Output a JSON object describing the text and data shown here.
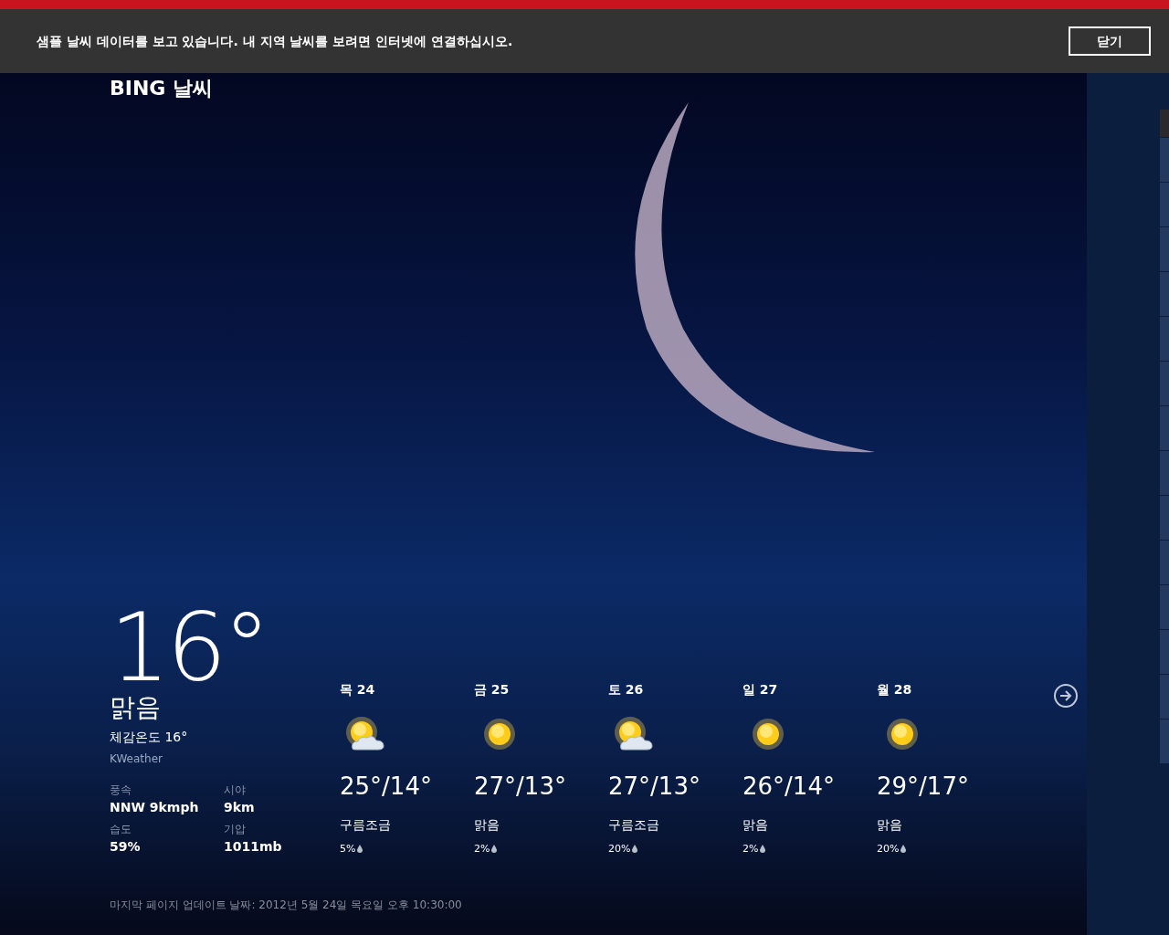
{
  "banner": {
    "message": "샘플 날씨 데이터를 보고 있습니다. 내 지역 날씨를 보려면 인터넷에 연결하십시오.",
    "button": "닫기"
  },
  "app_title": "BING 날씨",
  "current": {
    "temperature": "16°",
    "condition": "맑음",
    "feels_like": "체감온도 16°",
    "provider": "KWeather",
    "details": [
      {
        "label": "풍속",
        "value": "NNW 9kmph"
      },
      {
        "label": "시야",
        "value": "9km"
      },
      {
        "label": "습도",
        "value": "59%"
      },
      {
        "label": "기압",
        "value": "1011mb"
      }
    ]
  },
  "forecast": [
    {
      "day": "목 24",
      "kind": "partly-cloudy",
      "temps": "25°/14°",
      "condition": "구름조금",
      "precip": "5%"
    },
    {
      "day": "금 25",
      "kind": "sunny",
      "temps": "27°/13°",
      "condition": "맑음",
      "precip": "2%"
    },
    {
      "day": "토 26",
      "kind": "partly-cloudy",
      "temps": "27°/13°",
      "condition": "구름조금",
      "precip": "20%"
    },
    {
      "day": "일 27",
      "kind": "sunny",
      "temps": "26°/14°",
      "condition": "맑음",
      "precip": "2%"
    },
    {
      "day": "월 28",
      "kind": "sunny",
      "temps": "29°/17°",
      "condition": "맑음",
      "precip": "20%"
    }
  ],
  "footer": "마지막 페이지 업데이트 날짜: 2012년 5월 24일 목요일 오후 10:30:00"
}
